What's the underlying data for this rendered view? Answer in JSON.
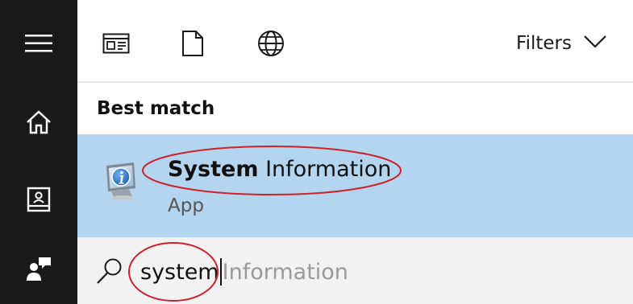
{
  "sidebar": {
    "items": [
      {
        "icon": "hamburger-menu-icon"
      },
      {
        "icon": "home-icon"
      },
      {
        "icon": "notebook-icon"
      },
      {
        "icon": "feedback-icon"
      }
    ]
  },
  "toolbar": {
    "scopes": [
      {
        "icon": "apps-icon"
      },
      {
        "icon": "documents-icon"
      },
      {
        "icon": "web-icon"
      }
    ],
    "filters_label": "Filters"
  },
  "results": {
    "heading": "Best match",
    "best": {
      "title_bold": "System",
      "title_rest": " Information",
      "subtitle": "App",
      "icon": "system-information-app-icon"
    }
  },
  "search": {
    "typed": "system",
    "suggestion": "Information"
  },
  "annotations": {
    "color": "#d0212b"
  }
}
